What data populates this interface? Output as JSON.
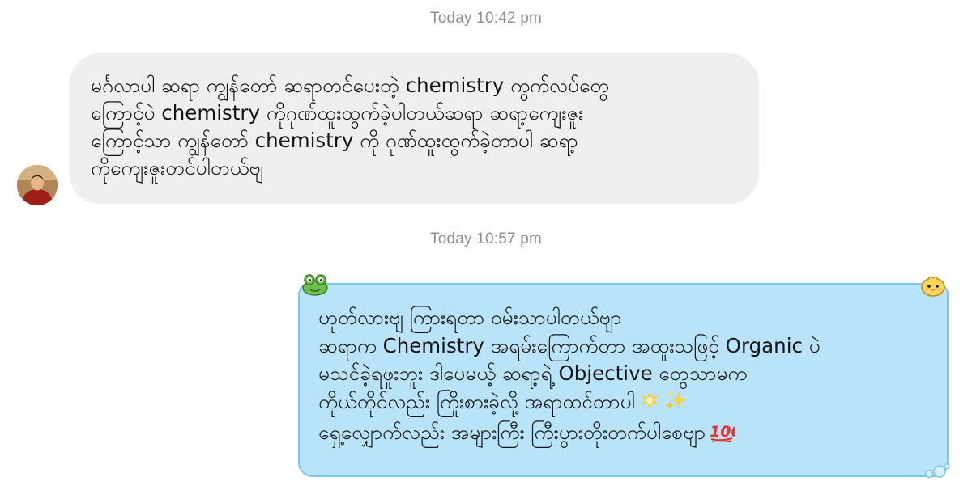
{
  "conversation": {
    "timestamp_1": "Today 10:42 pm",
    "timestamp_2": "Today 10:57 pm",
    "incoming": {
      "lines": [
        "မင်္ဂလာပါ ဆရာ ကျွန်တော် ဆရာတင်ပေးတဲ့ chemistry ကွက်လပ်တွေ",
        "ကြောင့်ပဲ chemistry ကိုဂုဏ်ထူးထွက်ခဲ့ပါတယ်ဆရာ ဆရာ့ကျေးဇူး",
        "ကြောင့်သာ ကျွန်တော် chemistry ကို ဂုဏ်ထူးထွက်ခဲ့တာပါ ဆရာ့",
        "ကိုကျေးဇူးတင်ပါတယ်ဗျ"
      ]
    },
    "outgoing": {
      "lines": [
        "ဟုတ်လားဗျ ကြားရတာ ဝမ်းသာပါတယ်ဗျာ",
        "ဆရာက Chemistry အရမ်းကြောက်တာ အထူးသဖြင့် Organic ပဲ",
        "မသင်ခဲ့ရဖူးဘူး ဒါပေမယ့် ဆရာ့ရဲ့ Objective တွေသာမက",
        "ကိုယ်တိုင်လည်း ကြိုးစားခဲ့လို့ အရာထင်တာပါ",
        "ရှေ့လျှောက်လည်း အများကြီး ကြီးပွားတိုးတက်ပါစေဗျာ"
      ],
      "emoji_line4": [
        "glowing-star-icon",
        "sparkles-icon"
      ],
      "emoji_line5": [
        "hundred-points-icon"
      ]
    },
    "colors": {
      "incoming_bubble": "#efefef",
      "outgoing_bubble": "#b9e3f8",
      "outgoing_border": "#7fc7ea",
      "timestamp": "#8e8e93"
    }
  }
}
